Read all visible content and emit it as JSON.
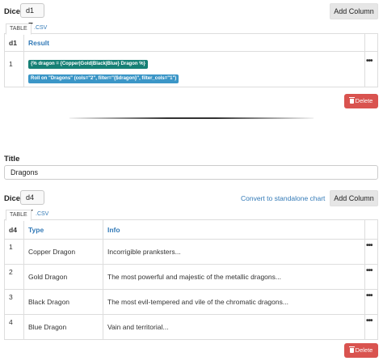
{
  "table1": {
    "dice_label": "Dice",
    "dice_value": "d1",
    "add_column_label": "Add Column",
    "tabs": [
      "TABLE",
      ".CSV"
    ],
    "headers": [
      "d1",
      "Result"
    ],
    "rows": [
      {
        "roll": "1",
        "tag1": "{% dragon = {Copper|Gold|Black|Blue} Dragon %}",
        "tag2": "Roll on \"Dragons\" (cols=\"2\", filter=\"{$dragon}\", filter_cols=\"1\")"
      }
    ],
    "row_menu": "•••",
    "delete_label": "Delete"
  },
  "table2": {
    "title_label": "Title",
    "title_value": "Dragons",
    "dice_label": "Dice",
    "dice_value": "d4",
    "convert_label": "Convert to standalone chart",
    "add_column_label": "Add Column",
    "tabs": [
      "TABLE",
      ".CSV"
    ],
    "headers": [
      "d4",
      "Type",
      "Info"
    ],
    "rows": [
      {
        "roll": "1",
        "type": "Copper Dragon",
        "info": "Incorrigible pranksters..."
      },
      {
        "roll": "2",
        "type": "Gold Dragon",
        "info": "The most powerful and majestic of the metallic dragons..."
      },
      {
        "roll": "3",
        "type": "Black Dragon",
        "info": "The most evil-tempered and vile of the chromatic dragons..."
      },
      {
        "roll": "4",
        "type": "Blue Dragon",
        "info": "Vain and territorial..."
      }
    ],
    "row_menu": "•••",
    "delete_label": "Delete"
  },
  "colors": {
    "accent": "#337ab7",
    "danger": "#d9534f",
    "tag_teal": "#168075",
    "tag_sky": "#3b96c7"
  },
  "icons": {
    "dropdown": "caret-down-icon",
    "delete": "trash-icon",
    "row_menu": "ellipsis-icon"
  }
}
